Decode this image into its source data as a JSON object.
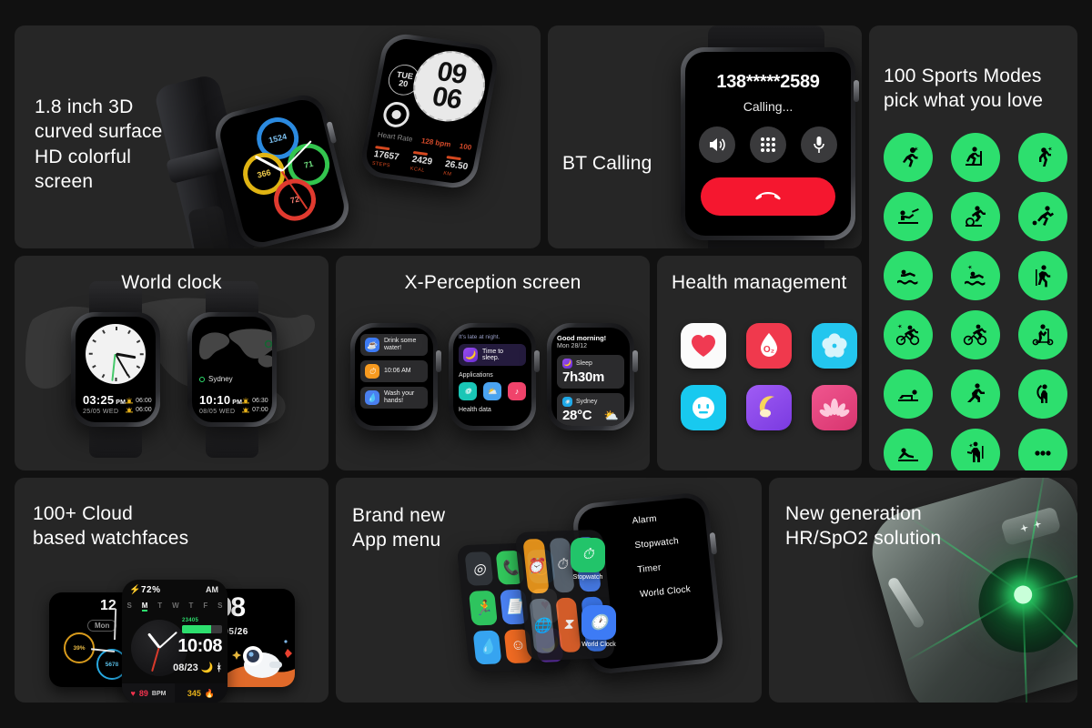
{
  "theme": {
    "page_bg": "#111111",
    "card_bg": "#262626",
    "accent_green": "#2ddf6e",
    "accent_red": "#f5172f",
    "text": "#ffffff"
  },
  "cards": {
    "display": {
      "title": "1.8 inch 3D\ncurved surface\nHD colorful\nscreen",
      "rings_watch": {
        "ring_steps": "1524",
        "ring_calories": "366",
        "ring_energy": "71",
        "ring_heart": "72"
      },
      "tilt_watch": {
        "hour": "09",
        "minute": "06",
        "weekday": "TUE",
        "day": "20",
        "hr_label": "Heart Rate",
        "hr_value": "128 bpm",
        "battery": "100",
        "battery_unit": "%",
        "stats": [
          {
            "value": "17657",
            "unit": "STEPS"
          },
          {
            "value": "2429",
            "unit": "KCAL"
          },
          {
            "value": "26.50",
            "unit": "KM"
          }
        ]
      }
    },
    "bt_calling": {
      "title": "BT Calling",
      "number": "138*****2589",
      "status": "Calling...",
      "buttons": [
        {
          "name": "speaker-icon",
          "glyph": "speaker"
        },
        {
          "name": "keypad-icon",
          "glyph": "keypad"
        },
        {
          "name": "microphone-icon",
          "glyph": "mic"
        }
      ],
      "end_call_label": "end-call"
    },
    "sports": {
      "title": "100 Sports Modes\npick what you love",
      "modes": [
        "running",
        "treadmill",
        "walking",
        "rowing",
        "spinning",
        "football",
        "swimming",
        "open-water-swim",
        "hiking",
        "mountain-bike",
        "cycling",
        "scooter",
        "push-up",
        "lunge",
        "stretching",
        "sit-up",
        "aerobics",
        "more"
      ]
    },
    "world_clock": {
      "title": "World clock",
      "watch_local": {
        "time": "03:25",
        "meridiem": "PM",
        "date": "25/05 WED",
        "sunrise": "06:00",
        "sunset": "06:00"
      },
      "watch_remote": {
        "city": "Sydney",
        "time": "10:10",
        "meridiem": "PM",
        "date": "08/05 WED",
        "sunrise": "06:30",
        "sunset": "07:00"
      }
    },
    "xperception": {
      "title": "X-Perception screen",
      "screen_reminders": [
        {
          "icon": "cup-icon",
          "text": "Drink some water!"
        },
        {
          "icon": "clock-icon",
          "text": "10:06 AM"
        },
        {
          "icon": "wash-hands-icon",
          "text": "Wash your hands!"
        }
      ],
      "screen_night": {
        "note": "It's late at night.",
        "sleep_prompt": "Time to sleep.",
        "applications_label": "Applications",
        "health_label": "Health data",
        "apps": [
          "breathe-icon",
          "weather-icon",
          "music-icon"
        ]
      },
      "screen_morning": {
        "greeting": "Good morning!",
        "date": "Mon  28/12",
        "sleep_label": "Sleep",
        "sleep_value": "7h30m",
        "city_label": "Sydney",
        "temperature": "28°C"
      }
    },
    "health": {
      "title": "Health management",
      "items": [
        "heart-rate-icon",
        "blood-oxygen-icon",
        "breathing-icon",
        "mood-icon",
        "sleep-icon",
        "relax-icon"
      ],
      "blood_oxygen_label": "O2"
    },
    "watchfaces": {
      "title": "100+ Cloud\nbased watchfaces",
      "face_left": {
        "hour_marker": "12",
        "month_label": "Mon",
        "sub_a": "39%",
        "sub_b": "5678",
        "sub_c": "5678"
      },
      "face_mid": {
        "battery": "72%",
        "meridiem": "AM",
        "weekdays": [
          "S",
          "M",
          "T",
          "W",
          "T",
          "F",
          "S"
        ],
        "active_day_index": 1,
        "steps": "23405",
        "time": "10:08",
        "date": "08/23",
        "bpm": "89",
        "bpm_unit": "BPM",
        "calories": "345"
      },
      "face_right": {
        "time": "0:08",
        "date": "Mon  05/26"
      }
    },
    "app_menu": {
      "title": "Brand new\nApp menu",
      "list_items": [
        "Alarm",
        "Stopwatch",
        "Timer",
        "World Clock"
      ],
      "floating_labels": [
        "Stopwatch",
        "World Clock"
      ],
      "grid_apps": [
        "activity-rings-icon",
        "phone-icon",
        "blood-oxygen-icon",
        "run-icon",
        "notes-icon",
        "heart-icon",
        "water-icon",
        "mood-icon",
        "sleep-icon"
      ]
    },
    "hr_spo2": {
      "title": "New generation\nHR/SpO2 solution"
    }
  }
}
